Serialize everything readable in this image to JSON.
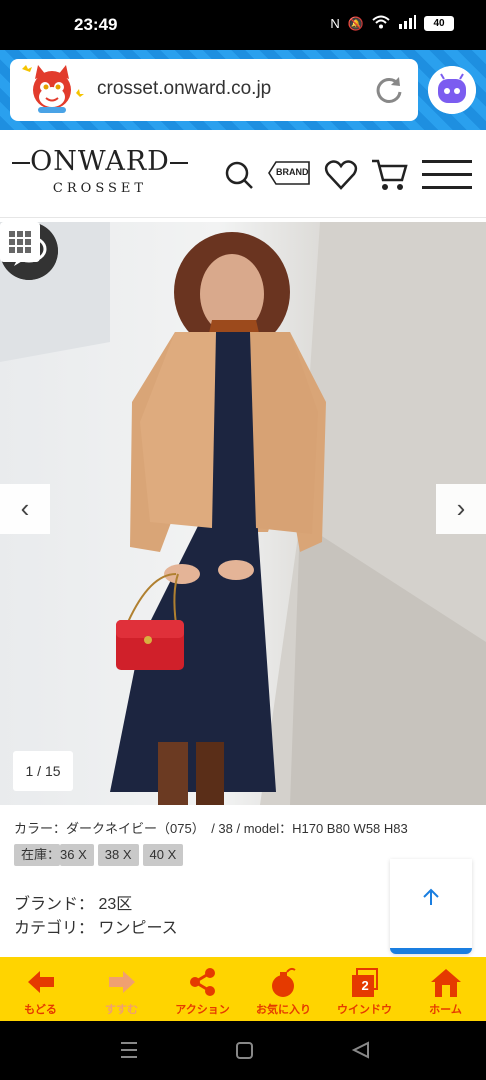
{
  "status_bar": {
    "time": "23:49",
    "battery": "40"
  },
  "browser": {
    "url": "crosset.onward.co.jp"
  },
  "header": {
    "logo_main": "ONWARD",
    "logo_sub": "CROSSET",
    "brand_label": "BRAND"
  },
  "gallery": {
    "counter": "1 / 15"
  },
  "product": {
    "meta": "カラー：ダークネイビー（075）　/  38  /  model：H170 B80 W58 H83",
    "stock_label": "在庫：",
    "sizes": [
      "36 X",
      "38 X",
      "40 X"
    ],
    "brand_label": "ブランド：",
    "brand_value": "23区",
    "category_label": "カテゴリ：",
    "category_value": "ワンピース"
  },
  "toolbar": {
    "items": [
      {
        "label": "もどる",
        "icon": "back-arrow-icon"
      },
      {
        "label": "すすむ",
        "icon": "forward-arrow-icon"
      },
      {
        "label": "アクション",
        "icon": "share-icon"
      },
      {
        "label": "お気に入り",
        "icon": "bomb-icon"
      },
      {
        "label": "ウインドウ",
        "icon": "window-icon"
      },
      {
        "label": "ホーム",
        "icon": "home-icon"
      }
    ],
    "window_count": "2"
  },
  "colors": {
    "toolbar_bg": "#ffd400",
    "toolbar_fg": "#e53a00",
    "browser_bg": "#2aa0ee",
    "accent_blue": "#1a7ee0"
  }
}
